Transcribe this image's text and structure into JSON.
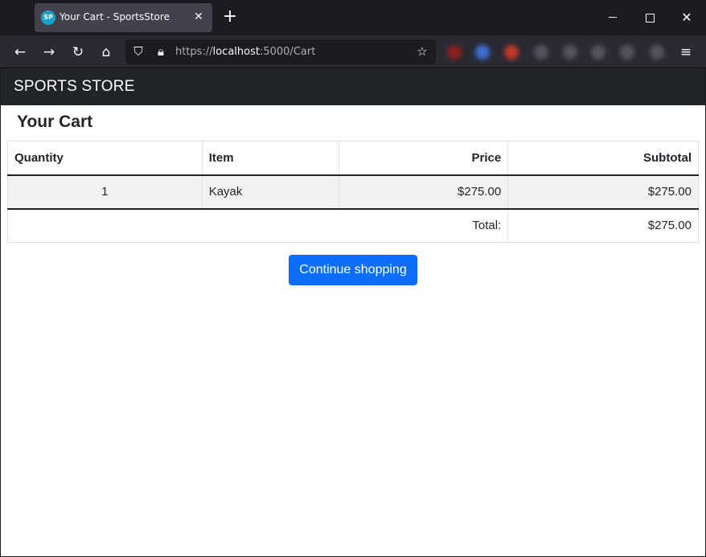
{
  "browser": {
    "tab_title": "Your Cart - SportsStore",
    "tab_favicon_text": "SP",
    "url_scheme": "https://",
    "url_host": "localhost",
    "url_path": ":5000/Cart",
    "icons": [
      "back-icon",
      "forward-icon",
      "reload-icon",
      "home-icon",
      "shield-icon",
      "lock-icon",
      "star-icon",
      "menu-icon"
    ]
  },
  "site": {
    "brand": "SPORTS STORE"
  },
  "cart": {
    "title": "Your Cart",
    "headers": {
      "quantity": "Quantity",
      "item": "Item",
      "price": "Price",
      "subtotal": "Subtotal"
    },
    "lines": [
      {
        "quantity": "1",
        "item": "Kayak",
        "price": "$275.00",
        "subtotal": "$275.00"
      }
    ],
    "total_label": "Total:",
    "total_value": "$275.00",
    "continue_label": "Continue shopping"
  },
  "colors": {
    "navbar": "#212529",
    "button": "#0d6efd",
    "row_stripe": "#f2f2f2"
  }
}
